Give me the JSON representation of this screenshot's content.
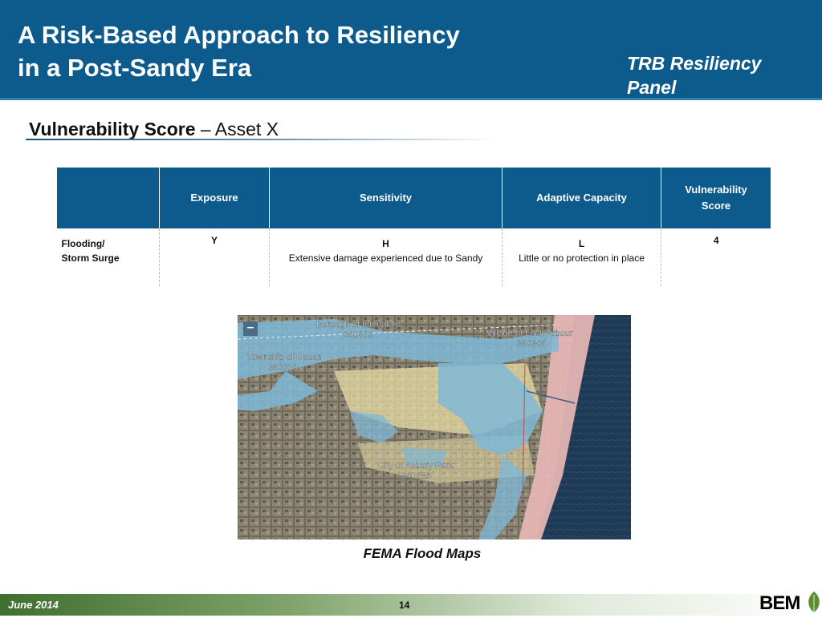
{
  "header": {
    "title_line1": "A Risk-Based Approach to Resiliency",
    "title_line2": "in a Post-Sandy Era",
    "panel_line1": "TRB Resiliency",
    "panel_line2": "Panel"
  },
  "subtitle": {
    "strong": "Vulnerability Score",
    "rest": " – Asset X"
  },
  "table": {
    "headers": [
      "",
      "Exposure",
      "Sensitivity",
      "Adaptive Capacity",
      "Vulnerability",
      "Score"
    ],
    "row": {
      "hazard_line1": "Flooding/",
      "hazard_line2": "Storm Surge",
      "exposure": "Y",
      "sensitivity_level": "H",
      "sensitivity_note": "Extensive damage experienced due to Sandy",
      "adaptive_level": "L",
      "adaptive_note": "Little or no protection in place",
      "score": "4"
    }
  },
  "map": {
    "zoom_label": "–",
    "labels": [
      "Borough of Interlaken",
      "340302",
      "Village of Loch Arbour",
      "340306",
      "Township of Ocean",
      "340019",
      "City of Asbury Park",
      "340285"
    ],
    "caption": "FEMA Flood Maps"
  },
  "footer": {
    "date": "June 2014",
    "page": "14",
    "logo": "BEM"
  },
  "colors": {
    "header_blue": "#0d5b8c",
    "footer_green": "#3f6f2f",
    "logo_blue": "#1f4e86",
    "flood_blue": "#7fb8d6",
    "coastal_pink": "#e8b7b5"
  }
}
